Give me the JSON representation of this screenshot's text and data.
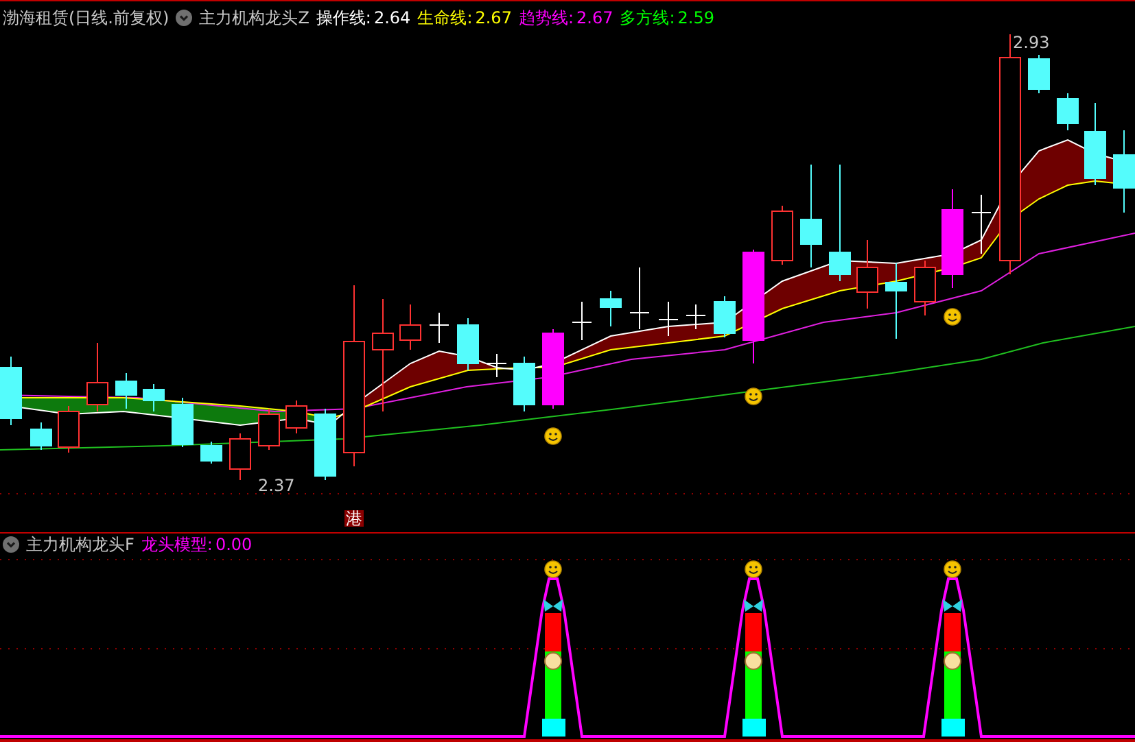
{
  "main_panel": {
    "stock": "渤海租赁(日线.前复权)",
    "indicator": "主力机构龙头Z",
    "legend": [
      {
        "label": "操作线:",
        "value": "2.64",
        "color": "#ffffff"
      },
      {
        "label": "生命线:",
        "value": "2.67",
        "color": "#ffff00"
      },
      {
        "label": "趋势线:",
        "value": "2.67",
        "color": "#ff00ff"
      },
      {
        "label": "多方线:",
        "value": "2.59",
        "color": "#00ff00"
      }
    ],
    "high_label": "2.93",
    "low_label": "2.37",
    "marker": "港"
  },
  "sub_panel": {
    "indicator": "主力机构龙头F",
    "legend": [
      {
        "label": "龙头模型:",
        "value": "0.00",
        "color": "#ff00ff"
      }
    ]
  }
}
